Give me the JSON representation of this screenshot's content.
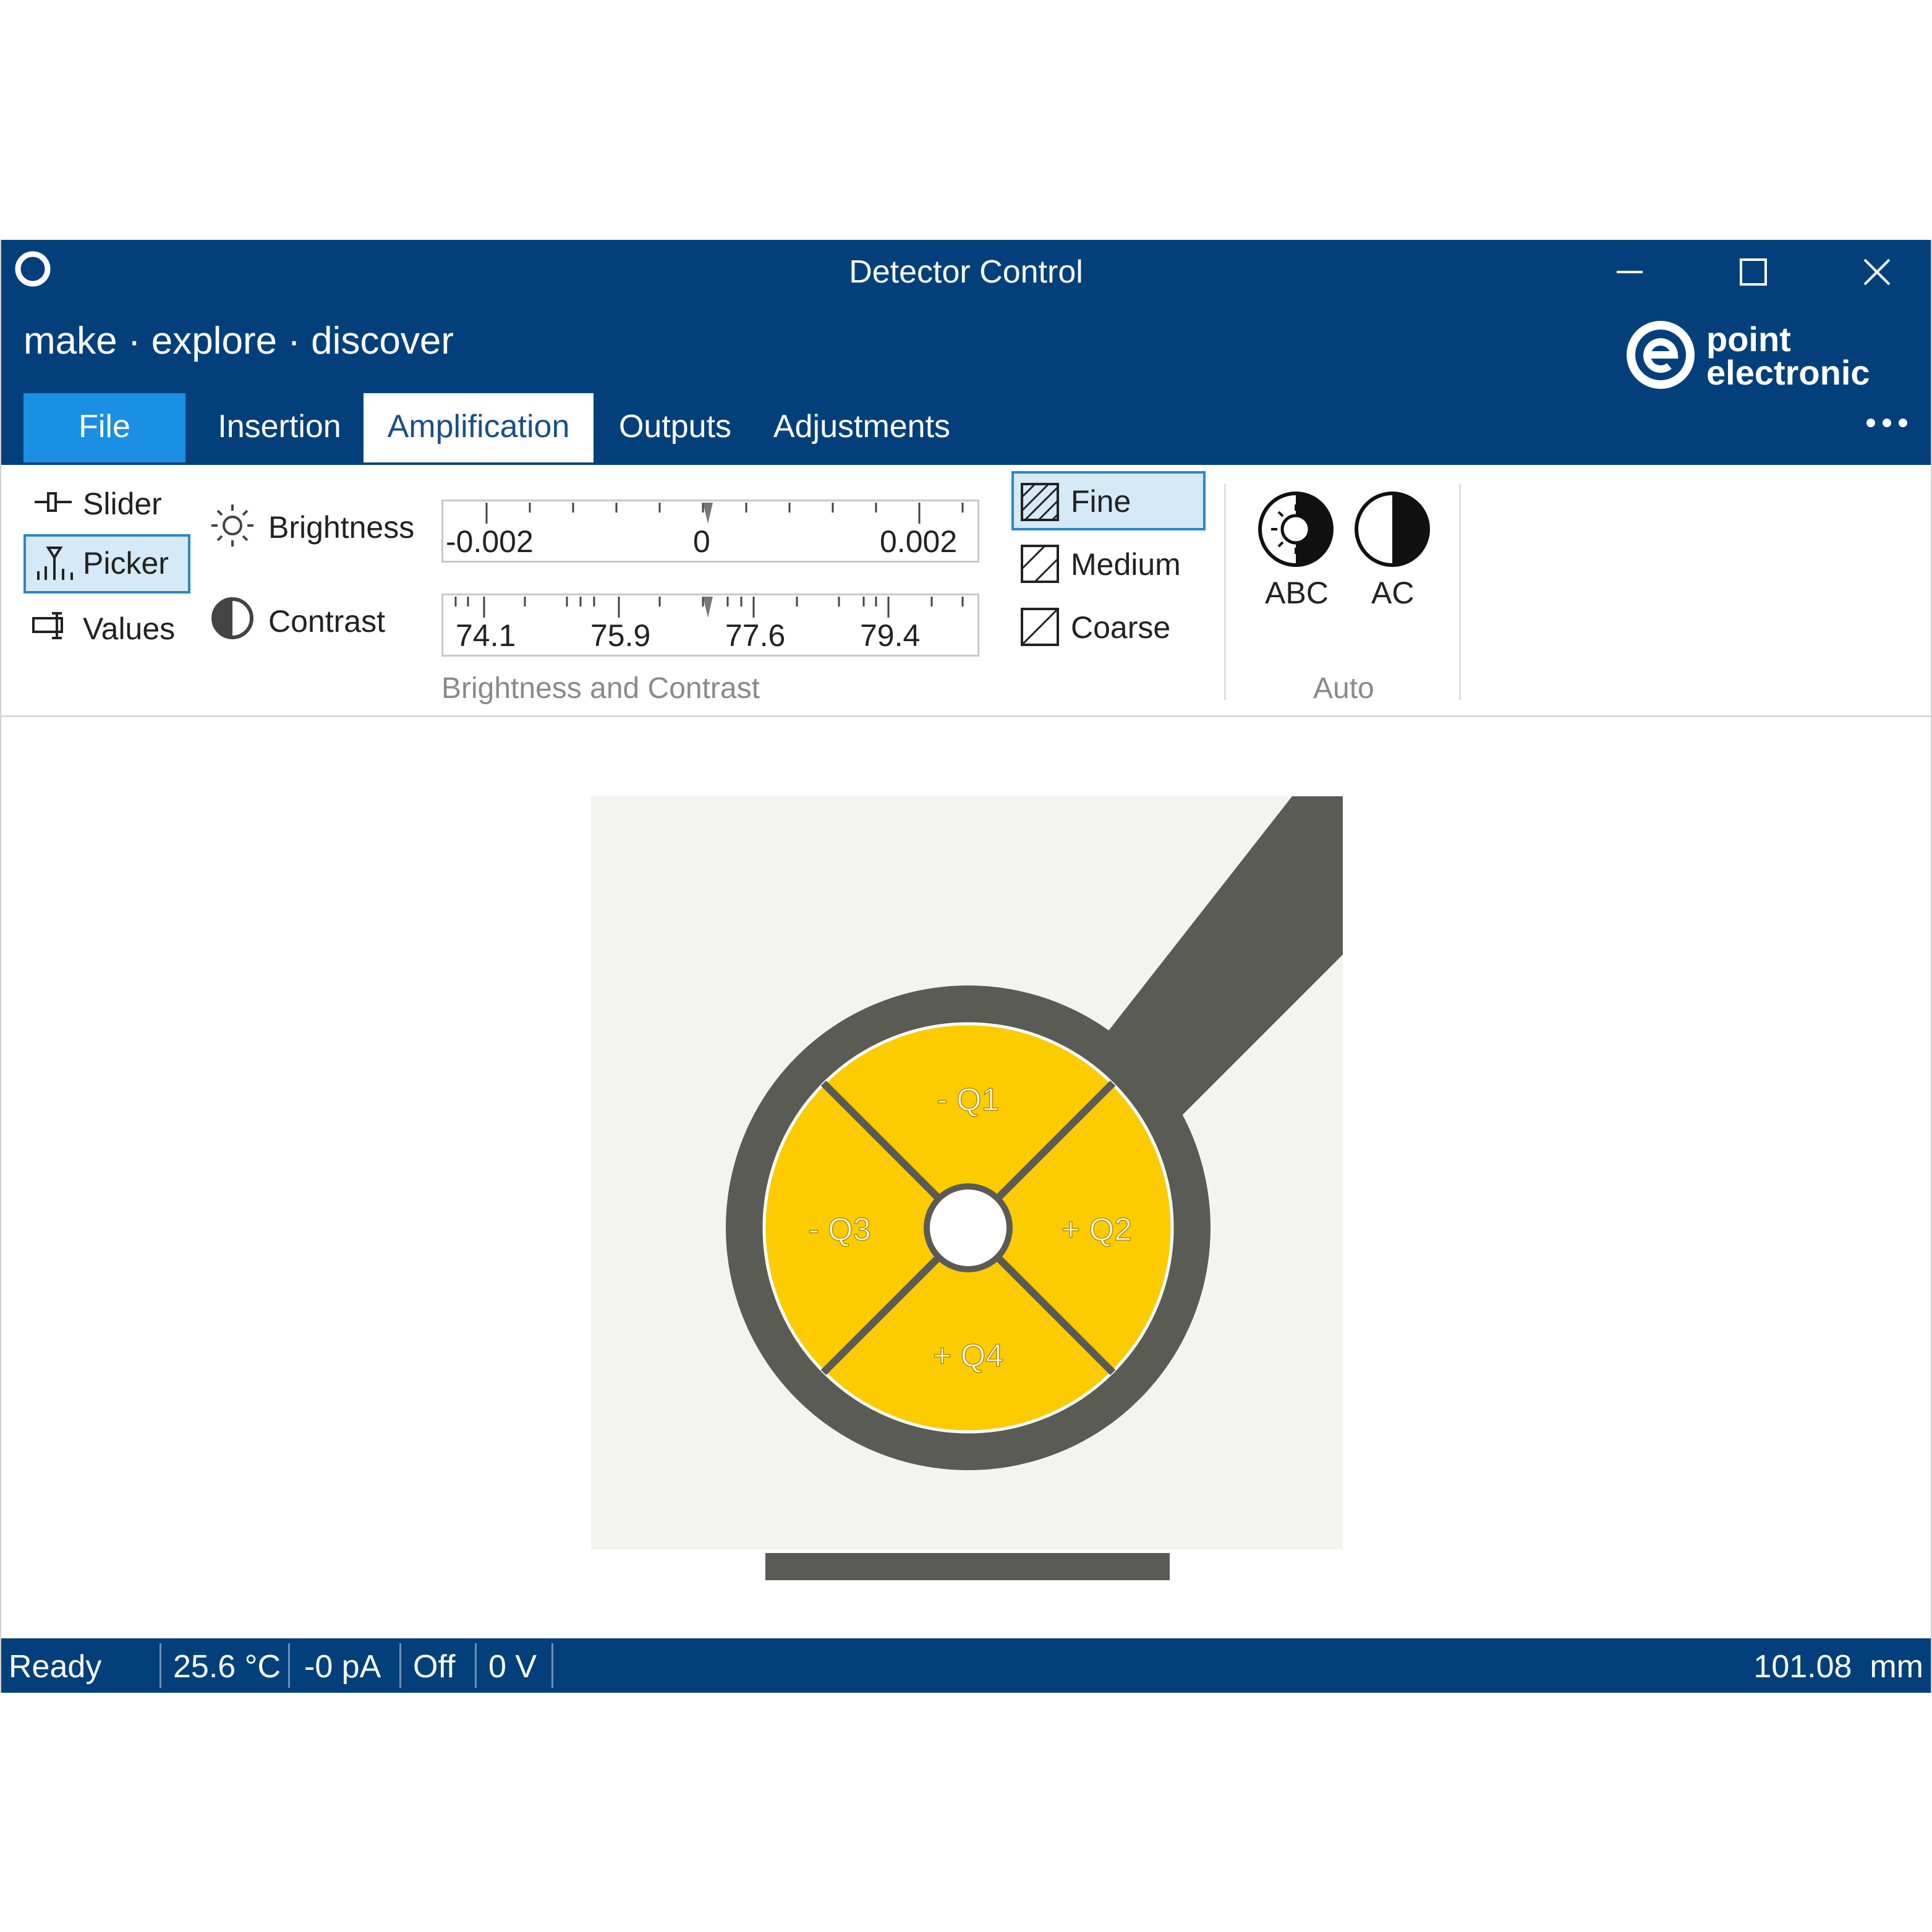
{
  "window": {
    "title": "Detector Control",
    "tagline": "make · explore · discover",
    "brand_line1": "point",
    "brand_line2": "electronic",
    "controls": [
      "minimize-icon",
      "maximize-icon",
      "close-icon"
    ]
  },
  "tabs": [
    {
      "label": "File"
    },
    {
      "label": "Insertion"
    },
    {
      "label": "Amplification",
      "active": true
    },
    {
      "label": "Outputs"
    },
    {
      "label": "Adjustments"
    }
  ],
  "ribbon": {
    "view_modes": [
      {
        "label": "Slider",
        "icon": "slider-icon"
      },
      {
        "label": "Picker",
        "icon": "picker-icon",
        "selected": true
      },
      {
        "label": "Values",
        "icon": "values-icon"
      }
    ],
    "brightness": {
      "label": "Brightness",
      "icon": "sun-icon",
      "ticks": [
        "-0.002",
        "0",
        "0.002"
      ],
      "value": 0
    },
    "contrast": {
      "label": "Contrast",
      "icon": "contrast-icon",
      "ticks": [
        "74.1",
        "75.9",
        "77.6",
        "79.4"
      ],
      "value": 77.6
    },
    "group_label_bc": "Brightness and Contrast",
    "step_sizes": [
      {
        "label": "Fine",
        "selected": true
      },
      {
        "label": "Medium"
      },
      {
        "label": "Coarse"
      }
    ],
    "auto": {
      "abc_label": "ABC",
      "ac_label": "AC",
      "group_label": "Auto"
    }
  },
  "detector": {
    "quadrants": [
      "- Q1",
      "+ Q2",
      "- Q3",
      "+ Q4"
    ],
    "colors": {
      "quadrant": "#fccb00",
      "housing": "#5b5b55",
      "background": "#f3f3f2"
    }
  },
  "status": {
    "state": "Ready",
    "temperature": "25.6 °C",
    "current": "-0 pA",
    "power": "Off",
    "voltage": "0 V",
    "distance": "101.08  mm"
  },
  "colors": {
    "titlebar": "#03407b",
    "file_tab": "#1a8fe3",
    "selection": "#d5e9f6",
    "accent": "#2b87c8"
  }
}
